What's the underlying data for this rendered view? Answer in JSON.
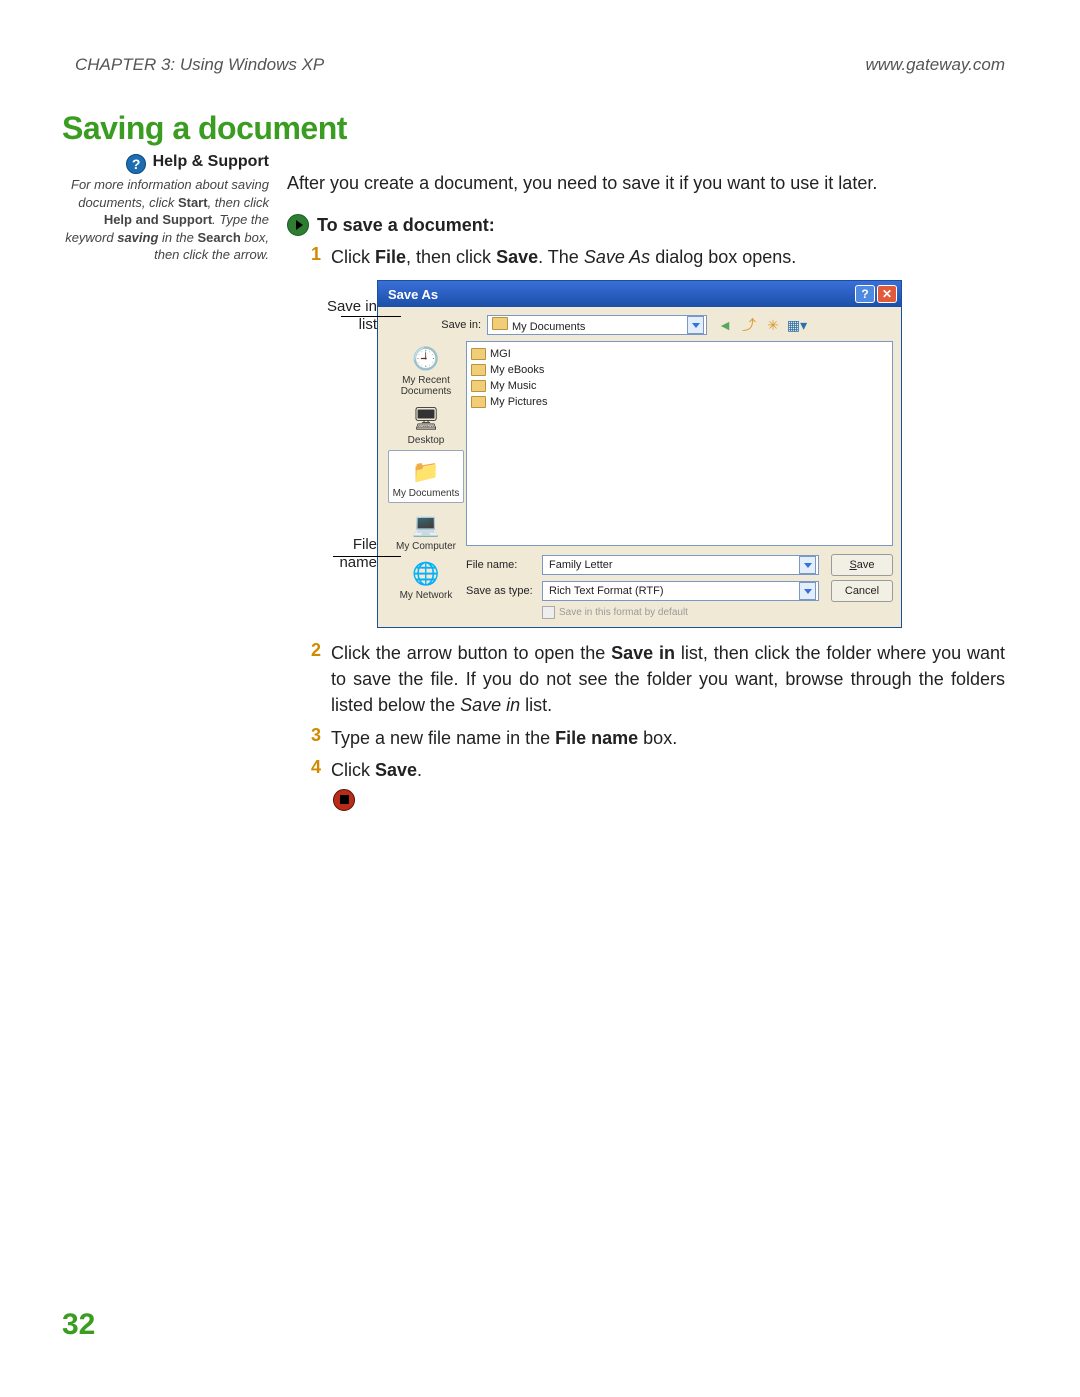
{
  "header": {
    "chapter": "CHAPTER 3: Using Windows XP",
    "site": "www.gateway.com"
  },
  "title": "Saving a document",
  "help": {
    "heading": "Help & Support",
    "body_prefix": "For more information about saving documents, click ",
    "b1": "Start",
    "body_mid1": ", then click ",
    "b2": "Help and Support",
    "body_mid2": ". Type the keyword ",
    "kw": "saving",
    "body_mid3": " in the ",
    "b3": "Search",
    "body_suffix": " box, then click the arrow."
  },
  "intro": "After you create a document, you need to save it if you want to use it later.",
  "procedure_title": "To save a document:",
  "steps": {
    "s1": {
      "num": "1",
      "pre": "Click ",
      "b1": "File",
      "mid": ", then click ",
      "b2": "Save",
      "post": ". The ",
      "it": "Save As",
      "tail": " dialog box opens."
    },
    "s2": {
      "num": "2",
      "pre": "Click the arrow button to open the ",
      "b1": "Save in",
      "mid": " list, then click the folder where you want to save the file. If you do not see the folder you want, browse through the folders listed below the ",
      "it": "Save in",
      "tail": " list."
    },
    "s3": {
      "num": "3",
      "pre": "Type a new file name in the ",
      "b1": "File name",
      "tail": " box."
    },
    "s4": {
      "num": "4",
      "pre": "Click ",
      "b1": "Save",
      "tail": "."
    }
  },
  "callouts": {
    "saveinA": "Save in",
    "saveinB": "list",
    "filenameA": "File",
    "filenameB": "name"
  },
  "dialog": {
    "title": "Save As",
    "savein_label": "Save in:",
    "savein_value": "My Documents",
    "places": {
      "recent": "My Recent Documents",
      "desktop": "Desktop",
      "mydocs": "My Documents",
      "mycomp": "My Computer",
      "mynet": "My Network"
    },
    "files": [
      "MGI",
      "My eBooks",
      "My Music",
      "My Pictures"
    ],
    "filename_label": "File name:",
    "filename_value": "Family Letter",
    "savetype_label": "Save as type:",
    "savetype_value": "Rich Text Format (RTF)",
    "save_btn": "Save",
    "cancel_btn": "Cancel",
    "checkbox": "Save in this format by default"
  },
  "page_number": "32"
}
